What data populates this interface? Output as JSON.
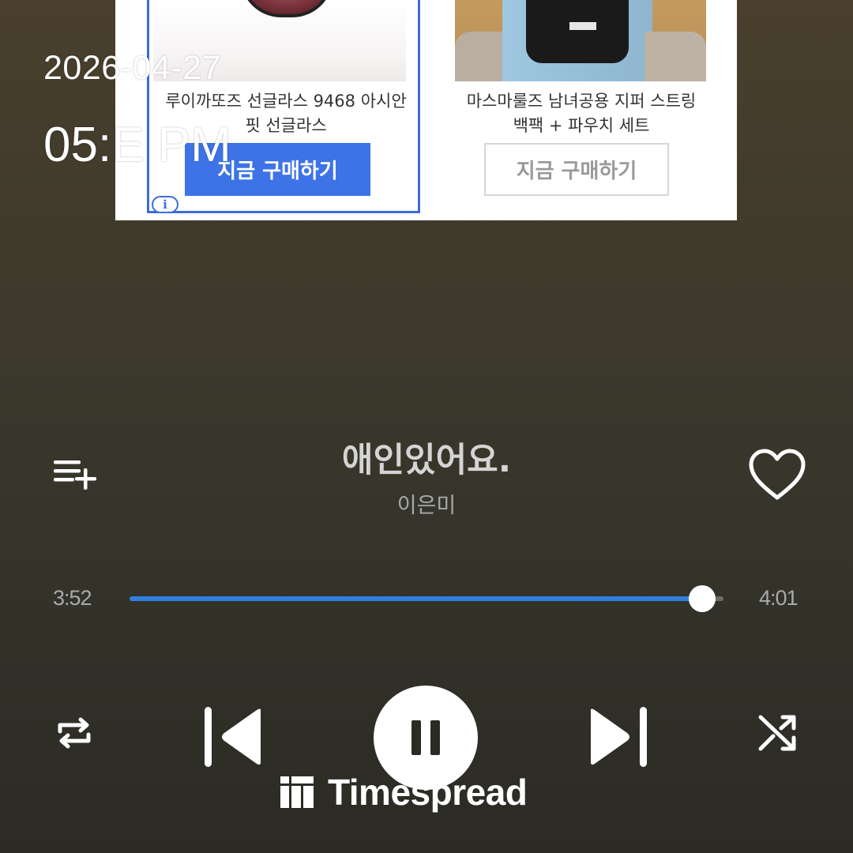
{
  "ad": {
    "products": [
      {
        "title_line1": "루이까또즈 선글라스 9468 아시안",
        "title_line2": "핏 선글라스",
        "button_label": "지금 구매하기"
      },
      {
        "title_line1": "마스마룰즈 남녀공용 지퍼 스트링",
        "title_line2": "백팩 + 파우치 세트",
        "button_label": "지금 구매하기"
      }
    ],
    "info_badge": "i",
    "accent_color": "#3d73e6"
  },
  "overlay": {
    "date": "2026-04-27",
    "time": "05:E  PM"
  },
  "player": {
    "song_title": "애인있어요.",
    "artist": "이은미",
    "elapsed": "3:52",
    "total": "4:01",
    "progress_fraction": 0.964,
    "progress_color": "#2f7fe0",
    "icons": {
      "add_to_playlist": "playlist-add-icon",
      "like": "heart-icon",
      "repeat": "repeat-icon",
      "previous": "skip-previous-icon",
      "pause": "pause-icon",
      "next": "skip-next-icon",
      "shuffle": "shuffle-icon"
    }
  },
  "watermark": {
    "text": "Timespread"
  }
}
